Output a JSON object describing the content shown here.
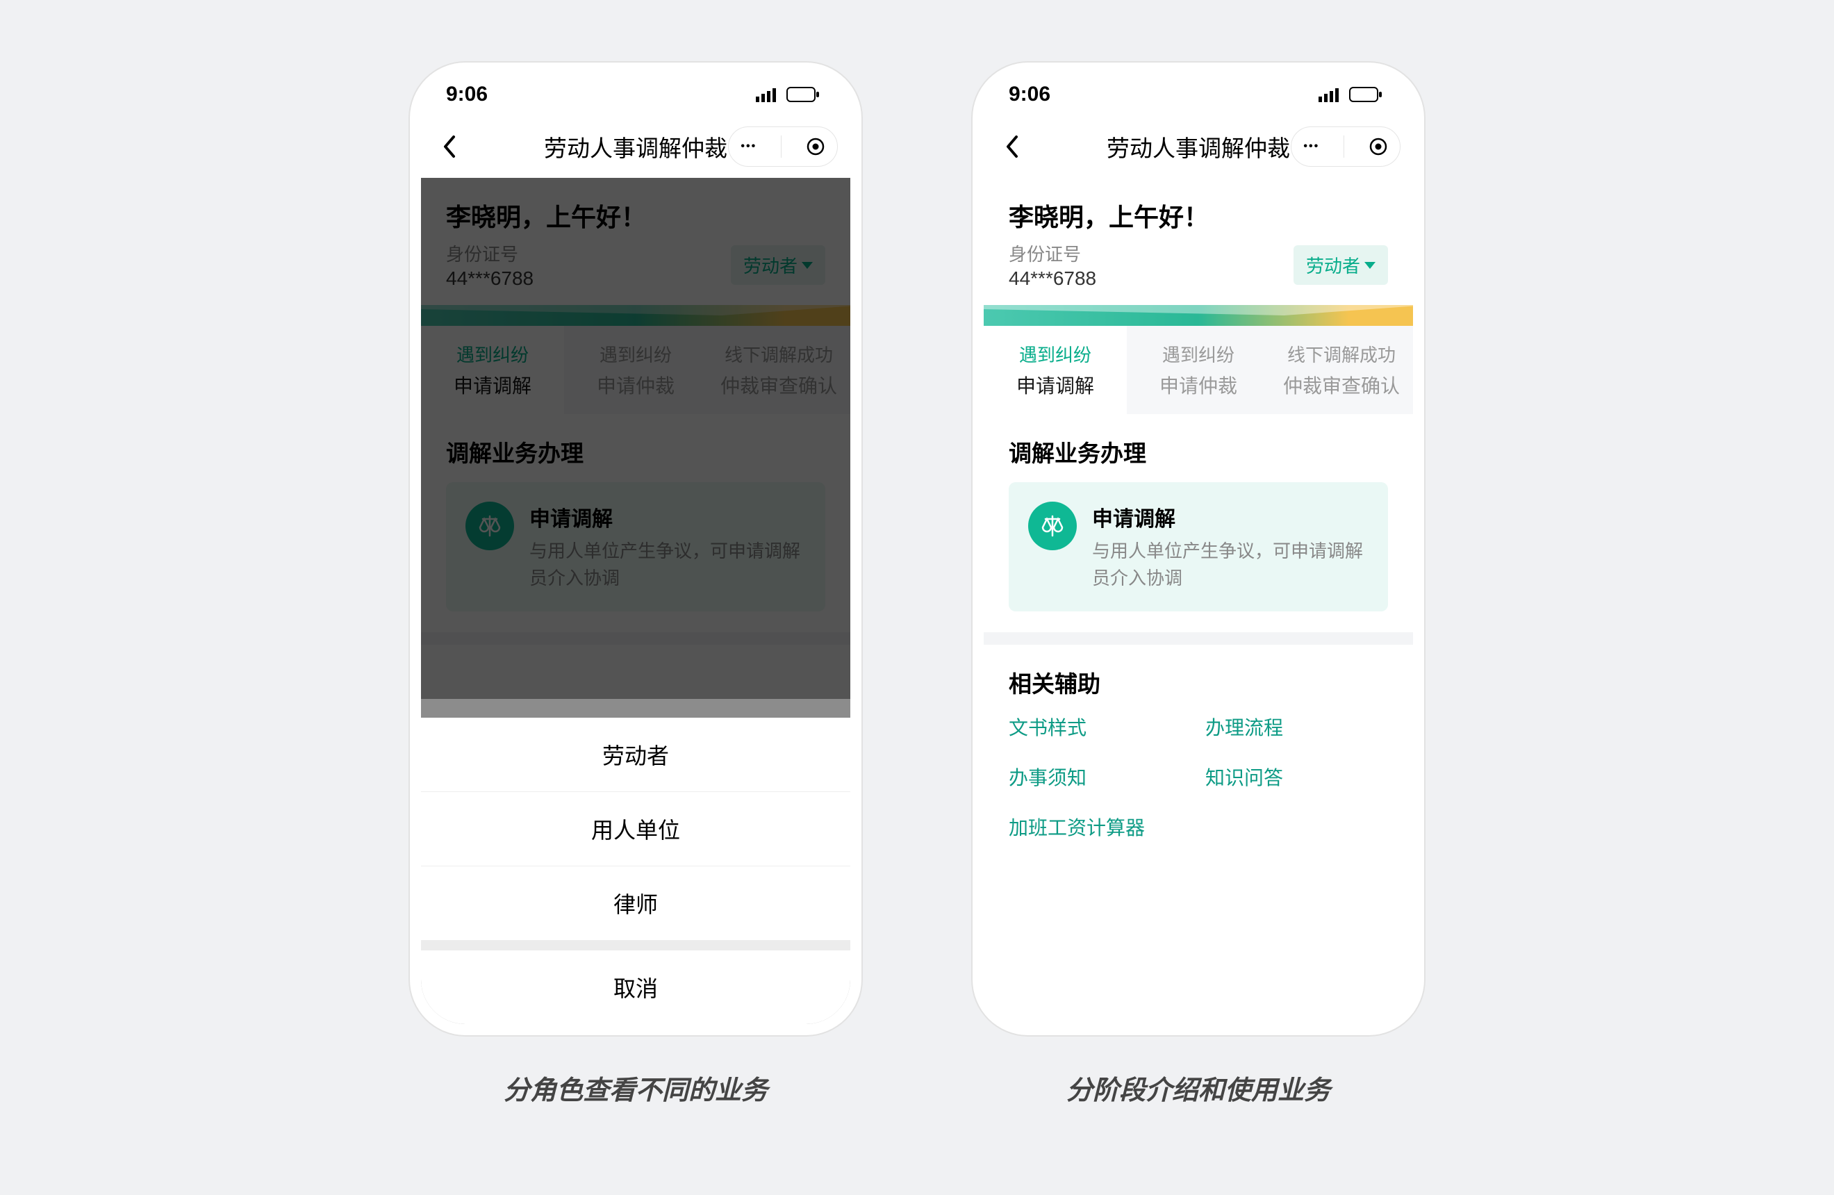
{
  "status": {
    "time": "9:06"
  },
  "nav": {
    "title": "劳动人事调解仲裁"
  },
  "user": {
    "greeting": "李晓明，上午好！",
    "id_label": "身份证号",
    "id_value": "44***6788",
    "role": "劳动者"
  },
  "tabs": [
    {
      "top": "遇到纠纷",
      "bottom": "申请调解"
    },
    {
      "top": "遇到纠纷",
      "bottom": "申请仲裁"
    },
    {
      "top": "线下调解成功",
      "bottom": "仲裁审查确认"
    }
  ],
  "service": {
    "section_title": "调解业务办理",
    "title": "申请调解",
    "desc": "与用人单位产生争议，可申请调解员介入协调"
  },
  "aux": {
    "section_title": "相关辅助",
    "links": [
      "文书样式",
      "办理流程",
      "办事须知",
      "知识问答",
      "加班工资计算器"
    ]
  },
  "sheet": {
    "options": [
      "劳动者",
      "用人单位",
      "律师"
    ],
    "cancel": "取消"
  },
  "captions": {
    "left": "分角色查看不同的业务",
    "right": "分阶段介绍和使用业务"
  }
}
